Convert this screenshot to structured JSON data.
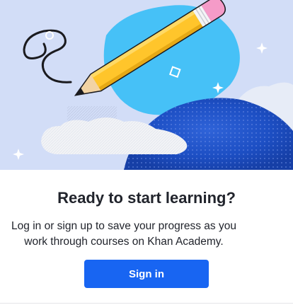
{
  "signin_card": {
    "title": "Ready to start learning?",
    "description": "Log in or sign up to save your progress as you work through courses on Khan Academy.",
    "signin_label": "Sign in"
  },
  "colors": {
    "primary_button": "#1865f2",
    "text": "#21242c",
    "hero_background": "#c9d6f5",
    "pencil_body": "#ffc52b",
    "eraser": "#f59bc8",
    "blob": "#46c1f7",
    "hill": "#1a4fc7"
  }
}
